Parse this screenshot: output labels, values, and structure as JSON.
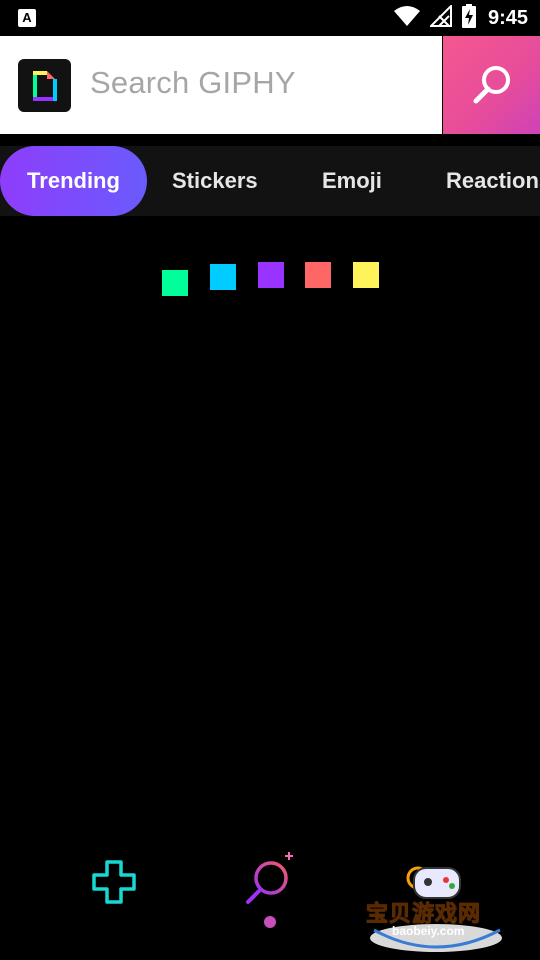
{
  "status_bar": {
    "left_icon_label": "A",
    "time": "9:45",
    "icons": [
      "wifi-icon",
      "no-signal-icon",
      "battery-charging-icon"
    ]
  },
  "search": {
    "placeholder": "Search GIPHY",
    "button_icon": "search-icon"
  },
  "tabs": [
    {
      "label": "Trending",
      "active": true
    },
    {
      "label": "Stickers",
      "active": false
    },
    {
      "label": "Emoji",
      "active": false
    },
    {
      "label": "Reactions",
      "active": false
    }
  ],
  "loader": {
    "colors": [
      "#00ff99",
      "#00ccff",
      "#9933ff",
      "#ff6666",
      "#fff35c"
    ]
  },
  "bottom_nav": {
    "items": [
      "create-plus-icon",
      "search-icon"
    ],
    "colors": {
      "create": "#19d7d1",
      "search_start": "#f6596b",
      "search_end": "#9b33f5",
      "dot": "#c84fbb"
    }
  },
  "watermark": {
    "title": "宝贝游戏网",
    "url": "baobeiy.com"
  }
}
